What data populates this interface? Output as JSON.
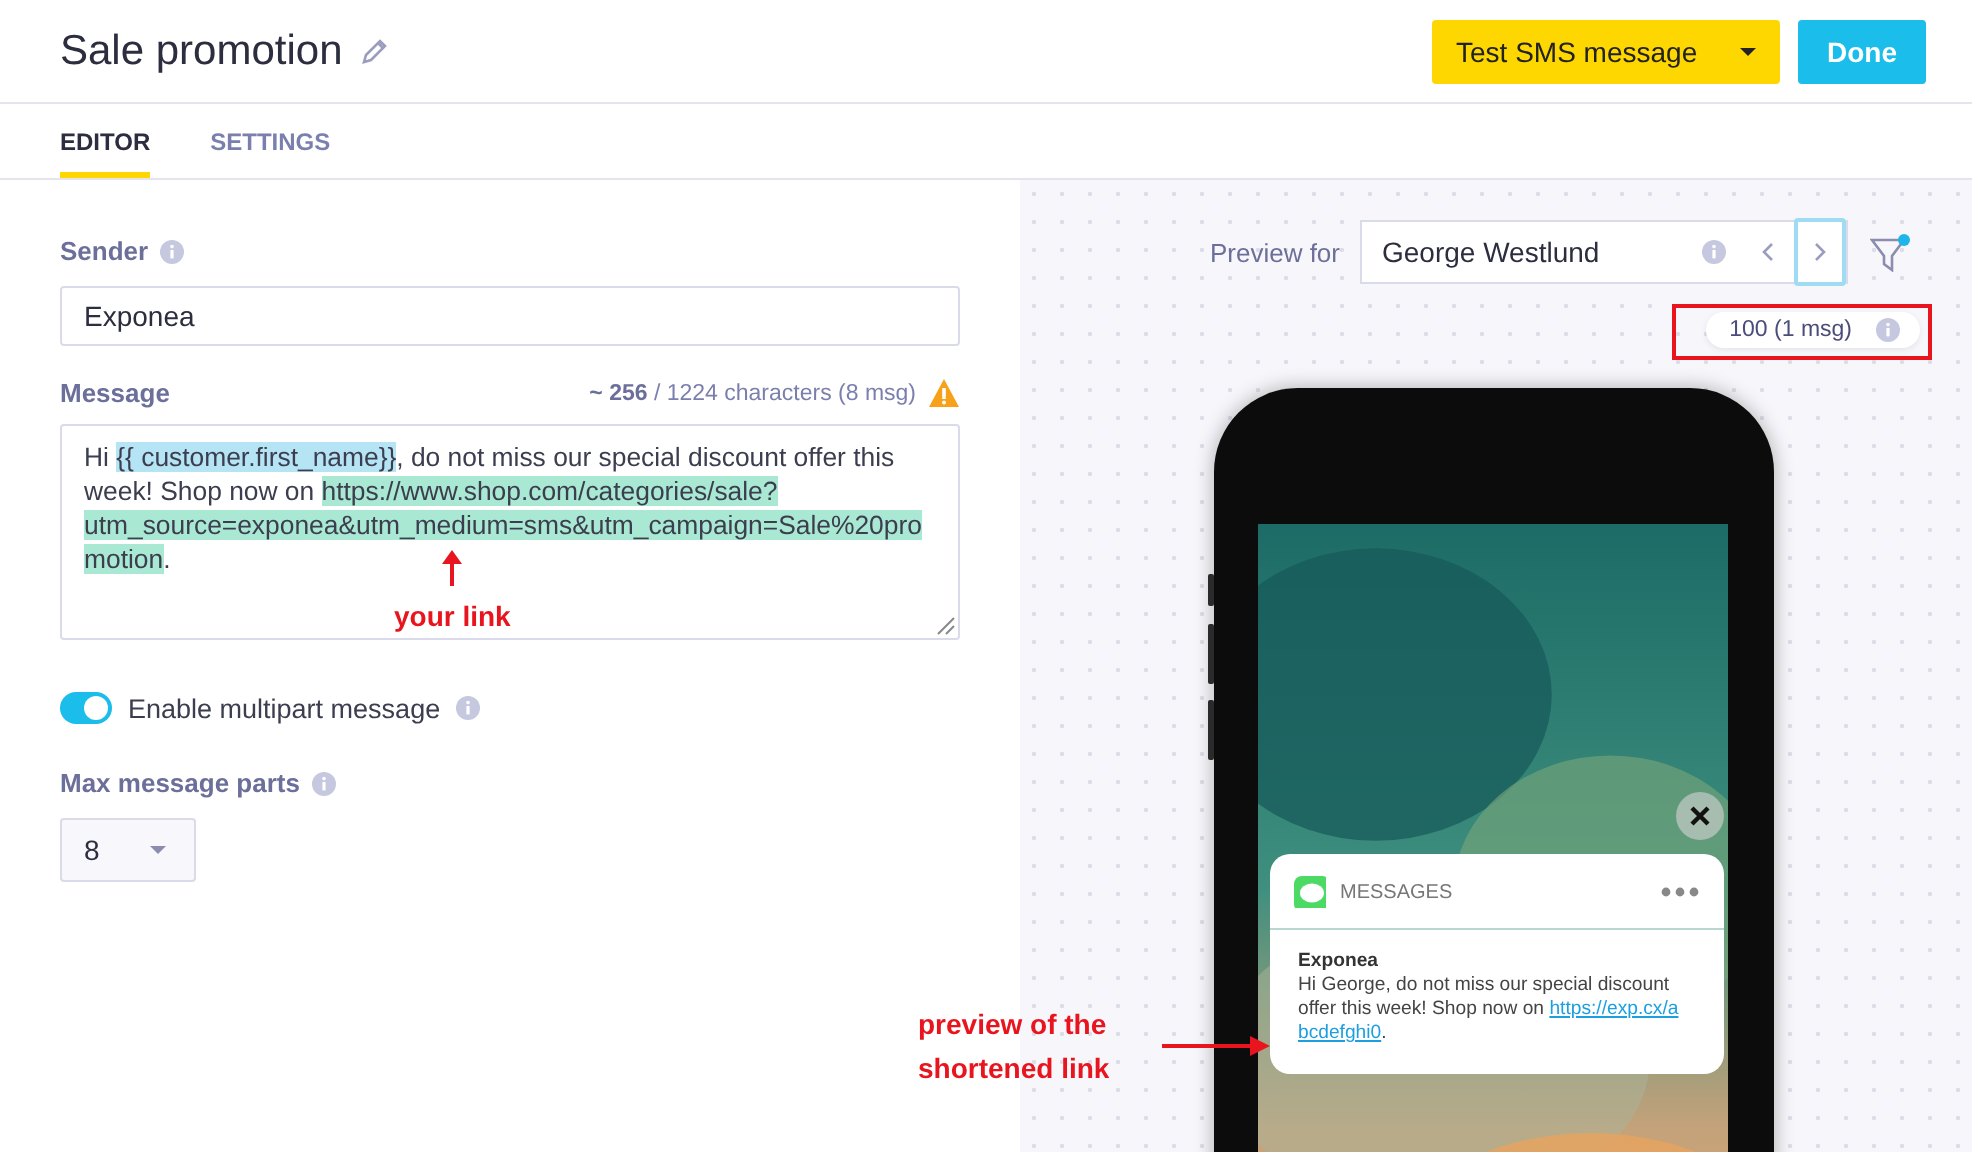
{
  "header": {
    "title": "Sale promotion",
    "buttons": [
      {
        "label": "Test SMS message",
        "kind": "split"
      },
      {
        "label": "Done",
        "kind": "primary"
      }
    ]
  },
  "tabs": [
    {
      "label": "EDITOR",
      "selected": true
    },
    {
      "label": "SETTINGS",
      "selected": false
    }
  ],
  "editor": {
    "sender": {
      "label": "Sender",
      "value": "Exponea"
    },
    "message": {
      "label": "Message",
      "count": "~ 256",
      "limit": "/ 1224 characters (8 msg)",
      "warning": true,
      "segments": [
        {
          "kind": "plain",
          "text": "Hi "
        },
        {
          "kind": "variable",
          "text": "{{ customer.first_name}}"
        },
        {
          "kind": "plain",
          "text": ", do not miss our special discount offer this week! Shop now on "
        },
        {
          "kind": "link",
          "text": "https://www.shop.com/categories/sale?utm_source=exponea&utm_medium=sms&utm_campaign=Sale%20promotion"
        },
        {
          "kind": "plain",
          "text": "."
        }
      ]
    },
    "multipart": {
      "label": "Enable multipart message",
      "on": true
    },
    "max_parts": {
      "label": "Max message parts",
      "value": "8"
    }
  },
  "preview": {
    "label": "Preview for",
    "customer": "George Westlund",
    "counter": "100 (1 msg)",
    "notification": {
      "app": "MESSAGES",
      "sender": "Exponea",
      "segments": [
        {
          "kind": "plain",
          "text": "Hi George, do not miss our special discount offer this week! Shop now on "
        },
        {
          "kind": "link",
          "text": "https://exp.cx/abcdefghi0"
        },
        {
          "kind": "plain",
          "text": "."
        }
      ]
    }
  },
  "annotations": [
    {
      "kind": "up",
      "text": "your link"
    },
    {
      "kind": "right",
      "text": "preview of the shortened link"
    },
    {
      "kind": "box"
    }
  ]
}
